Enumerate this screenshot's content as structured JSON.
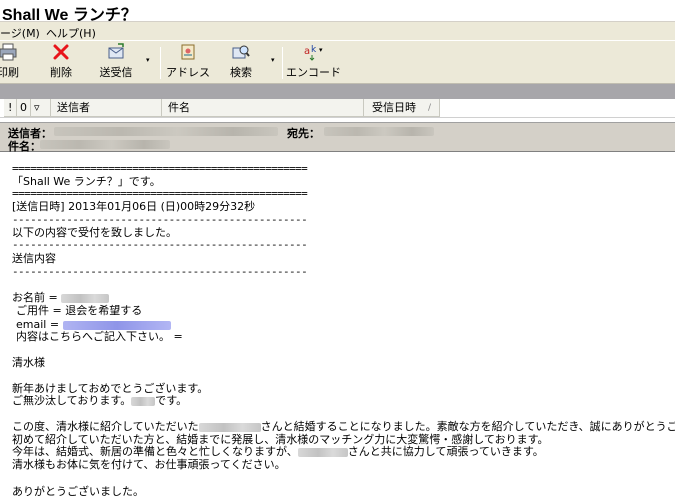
{
  "window": {
    "title": "Shall We ランチ？"
  },
  "menu": {
    "items": [
      "ージ(M)",
      "ヘルプ(H)"
    ]
  },
  "toolbar": {
    "buttons": [
      {
        "label": "印刷",
        "icon": "print-icon"
      },
      {
        "label": "削除",
        "icon": "delete-icon"
      },
      {
        "label": "送受信",
        "icon": "send-receive-icon"
      },
      {
        "label": "アドレス",
        "icon": "address-book-icon"
      },
      {
        "label": "検索",
        "icon": "search-icon"
      },
      {
        "label": "エンコード",
        "icon": "encoding-icon"
      }
    ],
    "drop_arrow": "▾"
  },
  "list": {
    "columns": {
      "priority": "!",
      "attachment": "0",
      "flag": "ᵖ",
      "from": "送信者",
      "subject": "件名",
      "received": "受信日時"
    },
    "sort_indicator": "/"
  },
  "message": {
    "from_label": "送信者：",
    "to_label": "宛先：",
    "subject_label": "件名：",
    "body": {
      "rule": "=================================================",
      "rule_dash": "-------------------------------------------------",
      "intro": "「Shall We ランチ？」です。",
      "sent_datetime": "[送信日時] 2013年01月06日 (日)00時29分32秒",
      "accepted": "以下の内容で受付を致しました。",
      "section": "送信内容",
      "name_label": "お名前 = ",
      "purpose": "ご用件 = 退会を希望する",
      "email_label": "email = ",
      "content": "内容はこちらへご記入下さい。 =",
      "salutation": "清水様",
      "greeting1": "新年あけましておめでとうございます。",
      "greeting2a": "ご無沙汰しております。",
      "greeting2b": "です。",
      "p1a": "この度、清水様に紹介していただいた",
      "p1b": "さんと結婚することになりました。素敵な方を紹介していただき、誠にありがとうございました。",
      "p2": "初めて紹介していただいた方と、結婚までに発展し、清水様のマッチング力に大変驚愕・感謝しております。",
      "p3a": "今年は、結婚式、新居の準備と色々と忙しくなりますが、",
      "p3b": "さんと共に協力して頑張っていきます。",
      "p4": "清水様もお体に気を付けて、お仕事頑張ってください。",
      "closing": "ありがとうございました。"
    }
  },
  "colors": {
    "chrome": "#ece9d8",
    "separator_bar": "#a7a6aa",
    "delete_red": "#e8141a",
    "link_blue": "#2e2ed6"
  }
}
